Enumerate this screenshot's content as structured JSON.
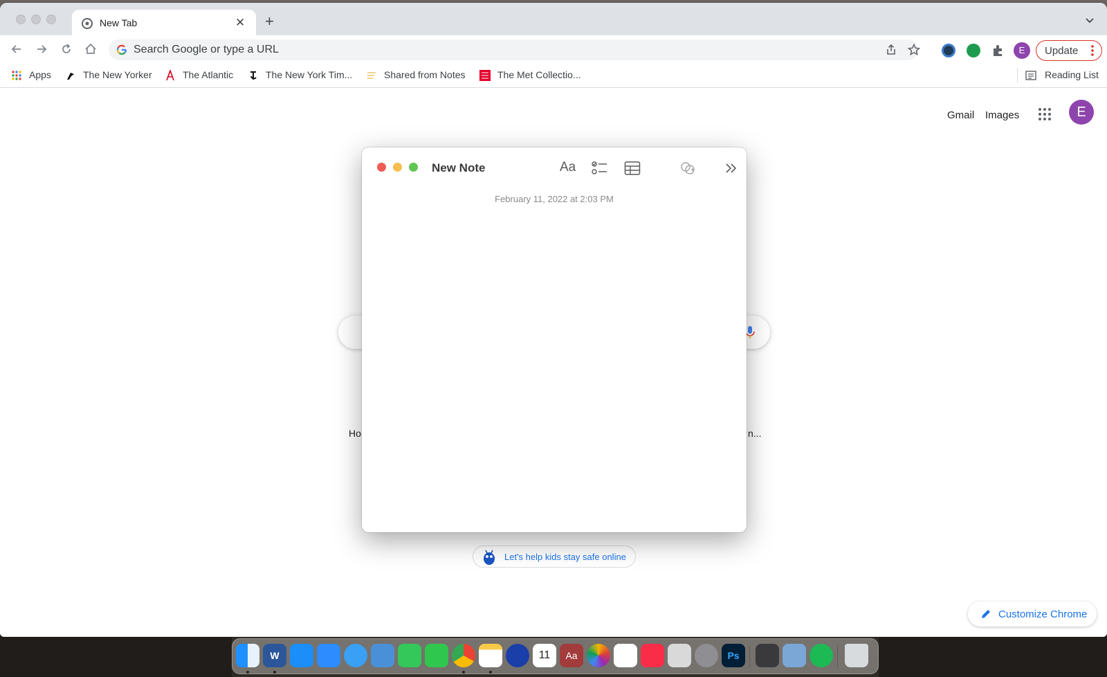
{
  "browser": {
    "tab_title": "New Tab",
    "close_glyph": "✕",
    "new_tab_glyph": "+",
    "omnibox_placeholder": "Search Google or type a URL",
    "profile_initial": "E",
    "update_label": "Update"
  },
  "bookmarks": [
    {
      "label": "Apps",
      "icon": "apps-grid-icon"
    },
    {
      "label": "The New Yorker",
      "icon": "new-yorker-icon"
    },
    {
      "label": "The Atlantic",
      "icon": "atlantic-icon"
    },
    {
      "label": "The New York Tim...",
      "icon": "nyt-icon"
    },
    {
      "label": "Shared from Notes",
      "icon": "notes-icon"
    },
    {
      "label": "The Met Collectio...",
      "icon": "met-icon"
    }
  ],
  "reading_list": "Reading List",
  "google": {
    "gmail": "Gmail",
    "images": "Images",
    "avatar_initial": "E",
    "shortcut_left": "Ho",
    "shortcut_right": "n...",
    "promo": "Let's help kids stay safe online",
    "customize": "Customize Chrome"
  },
  "note": {
    "title": "New Note",
    "format_glyph": "Aa",
    "date": "February 11, 2022 at 2:03 PM"
  },
  "dock": {
    "apps": [
      "Finder",
      "Word",
      "App Store",
      "Zoom",
      "Safari",
      "Keynote",
      "Messages",
      "FaceTime",
      "Chrome",
      "Notes",
      "Audacity",
      "Calendar",
      "Dictionary",
      "Photos",
      "Reminders",
      "Music",
      "Launchpad",
      "System Preferences",
      "Photoshop",
      "Calculator",
      "Preview",
      "Spotify",
      "Trash"
    ],
    "word_glyph": "W",
    "calendar_day": "11",
    "dictionary_glyph": "Aa",
    "photoshop_glyph": "Ps"
  },
  "colors": {
    "accent_blue": "#1a73e8",
    "profile_purple": "#8e44ad",
    "update_red": "#d93025",
    "traffic_red": "#ee5c54",
    "traffic_yellow": "#f6bf4f",
    "traffic_green": "#62c554"
  }
}
